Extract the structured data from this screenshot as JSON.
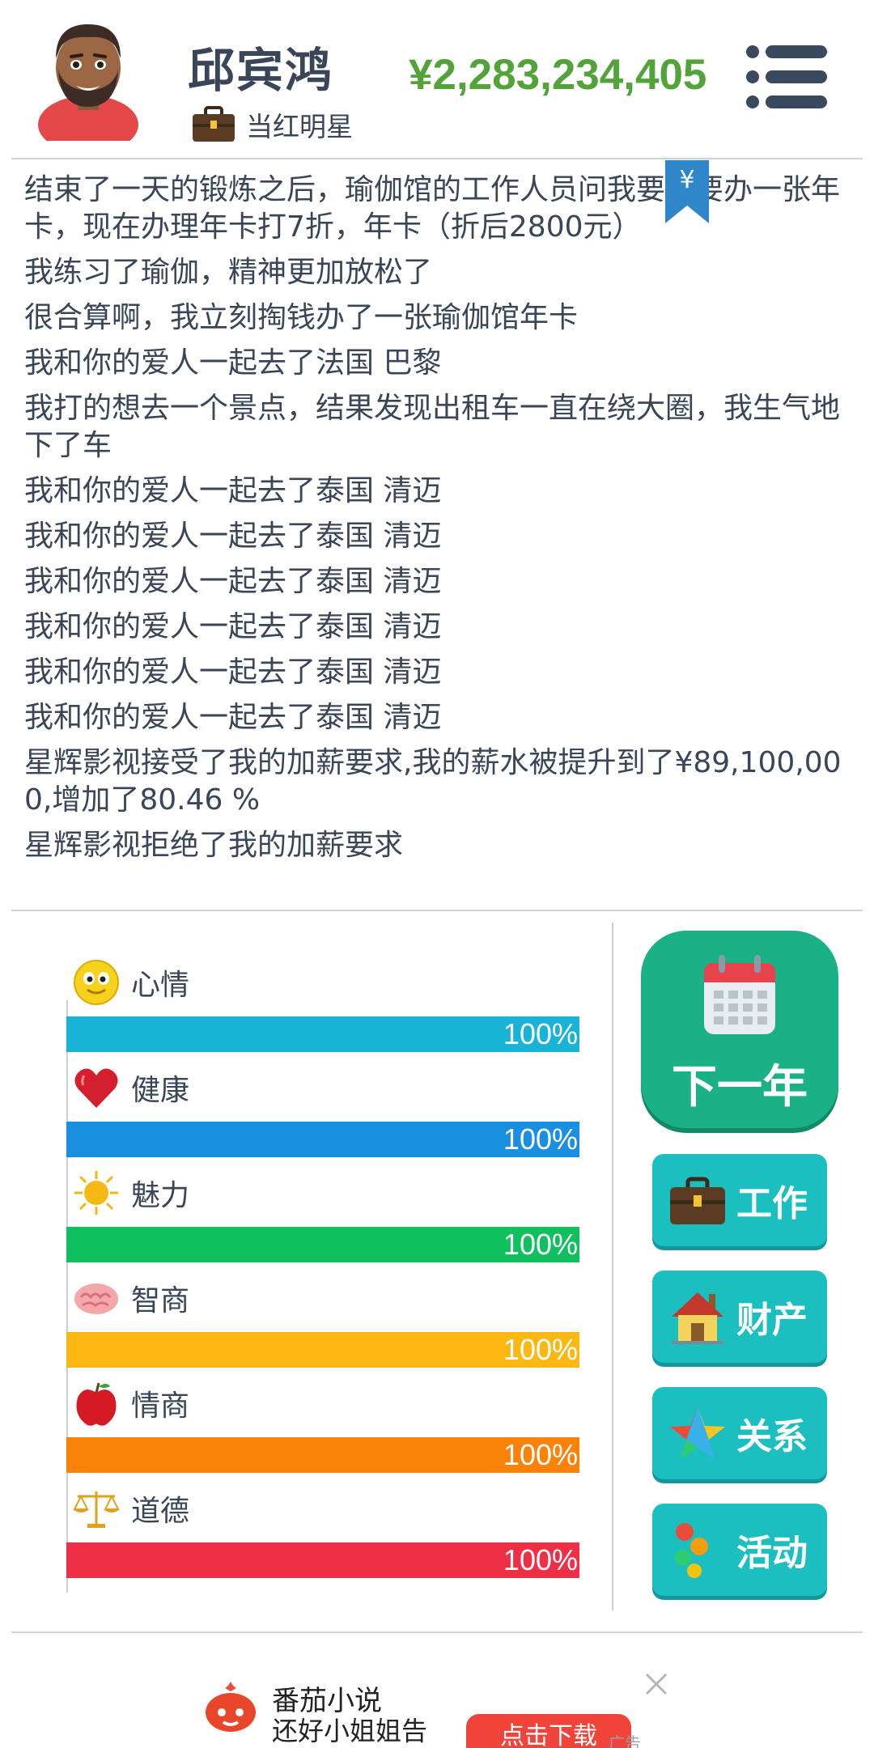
{
  "header": {
    "name": "邱宾鸿",
    "job_title": "当红明星",
    "money": "¥2,283,234,405"
  },
  "log": {
    "lines": [
      "结束了一天的锻炼之后，瑜伽馆的工作人员问我要不要办一张年卡，现在办理年卡打7折，年卡（折后2800元）",
      "我练习了瑜伽，精神更加放松了",
      "很合算啊，我立刻掏钱办了一张瑜伽馆年卡",
      "我和你的爱人一起去了法国 巴黎",
      "我打的想去一个景点，结果发现出租车一直在绕大圈，我生气地下了车",
      "我和你的爱人一起去了泰国 清迈",
      "我和你的爱人一起去了泰国 清迈",
      "我和你的爱人一起去了泰国 清迈",
      "我和你的爱人一起去了泰国 清迈",
      "我和你的爱人一起去了泰国 清迈",
      "我和你的爱人一起去了泰国 清迈",
      "星辉影视接受了我的加薪要求,我的薪水被提升到了¥89,100,000,增加了80.46 %",
      "星辉影视拒绝了我的加薪要求"
    ],
    "bookmark_symbol": "¥"
  },
  "stats": [
    {
      "label": "心情",
      "value": 1.0,
      "text": "100%",
      "color": "#1ab3d8",
      "icon": "smiley-icon"
    },
    {
      "label": "健康",
      "value": 1.0,
      "text": "100%",
      "color": "#1a8fe0",
      "icon": "heart-icon"
    },
    {
      "label": "魅力",
      "value": 1.0,
      "text": "100%",
      "color": "#10bf5e",
      "icon": "sun-icon"
    },
    {
      "label": "智商",
      "value": 1.0,
      "text": "100%",
      "color": "#fbb812",
      "icon": "brain-icon"
    },
    {
      "label": "情商",
      "value": 1.0,
      "text": "100%",
      "color": "#fb8208",
      "icon": "apple-icon"
    },
    {
      "label": "道德",
      "value": 1.0,
      "text": "100%",
      "color": "#ef2f45",
      "icon": "scales-icon"
    }
  ],
  "actions": {
    "next_year": "下一年",
    "work": "工作",
    "assets": "财产",
    "relations": "关系",
    "activities": "活动"
  },
  "ad": {
    "title": "番茄小说",
    "subtitle": "还好小姐姐告",
    "cta": "点击下载",
    "tag": "广告"
  },
  "colors": {
    "money": "#52a43a",
    "next_button": "#1ab187",
    "side_button": "#1bbfc0"
  }
}
